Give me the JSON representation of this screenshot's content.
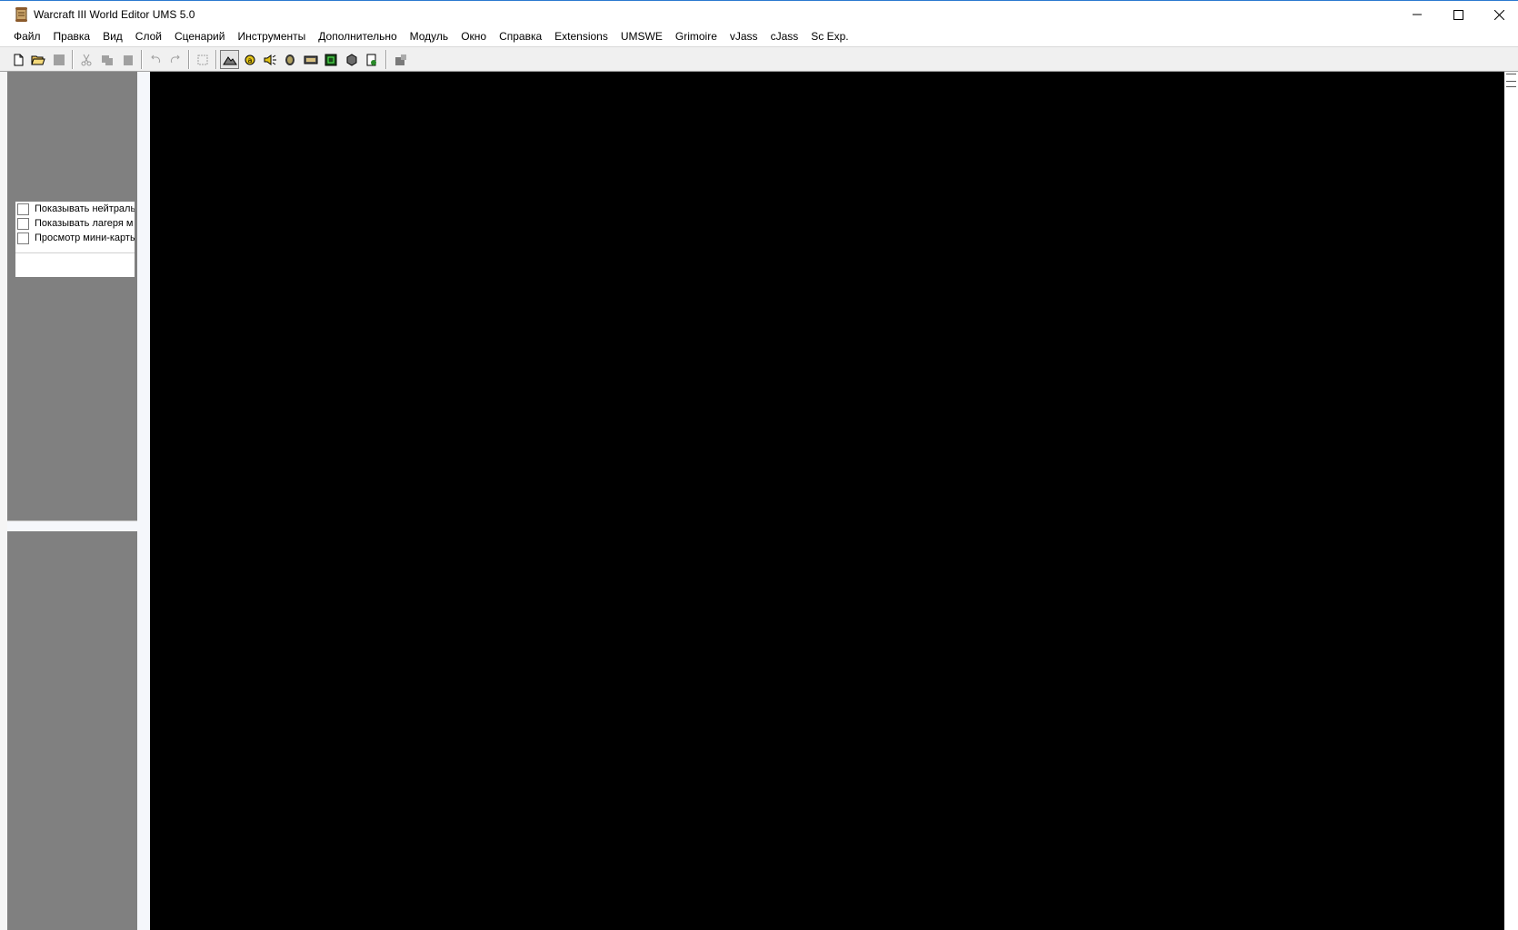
{
  "window": {
    "title": "Warcraft III World Editor UMS 5.0",
    "icon": "scroll-icon"
  },
  "menu": [
    {
      "label": "Файл"
    },
    {
      "label": "Правка"
    },
    {
      "label": "Вид"
    },
    {
      "label": "Слой"
    },
    {
      "label": "Сценарий"
    },
    {
      "label": "Инструменты"
    },
    {
      "label": "Дополнительно"
    },
    {
      "label": "Модуль"
    },
    {
      "label": "Окно"
    },
    {
      "label": "Справка"
    },
    {
      "label": "Extensions"
    },
    {
      "label": "UMSWE"
    },
    {
      "label": "Grimoire"
    },
    {
      "label": "vJass"
    },
    {
      "label": "cJass"
    },
    {
      "label": "Sc Exp."
    }
  ],
  "toolbar": {
    "buttons": [
      {
        "icon": "new-file-icon"
      },
      {
        "icon": "open-folder-icon"
      },
      {
        "icon": "save-icon",
        "disabled": true
      },
      {
        "icon": "cut-icon",
        "disabled": true
      },
      {
        "icon": "copy-icon",
        "disabled": true
      },
      {
        "icon": "paste-icon",
        "disabled": true
      },
      {
        "icon": "undo-icon",
        "disabled": true
      },
      {
        "icon": "redo-icon",
        "disabled": true
      },
      {
        "icon": "select-icon"
      },
      {
        "icon": "terrain-editor-icon",
        "pressed": true
      },
      {
        "icon": "trigger-editor-icon"
      },
      {
        "icon": "sound-editor-icon"
      },
      {
        "icon": "object-editor-icon"
      },
      {
        "icon": "campaign-editor-icon"
      },
      {
        "icon": "ai-editor-icon"
      },
      {
        "icon": "import-manager-icon"
      },
      {
        "icon": "test-map-icon"
      },
      {
        "icon": "module-icon"
      }
    ]
  },
  "left_panel": {
    "options": [
      {
        "label": "Показывать нейтральн",
        "checked": false
      },
      {
        "label": "Показывать лагеря м",
        "checked": false
      },
      {
        "label": "Просмотр мини-карты",
        "checked": false
      }
    ]
  },
  "colors": {
    "panel_bg": "#808080",
    "viewport_bg": "#000000",
    "toolbar_bg": "#f0f0f0"
  }
}
